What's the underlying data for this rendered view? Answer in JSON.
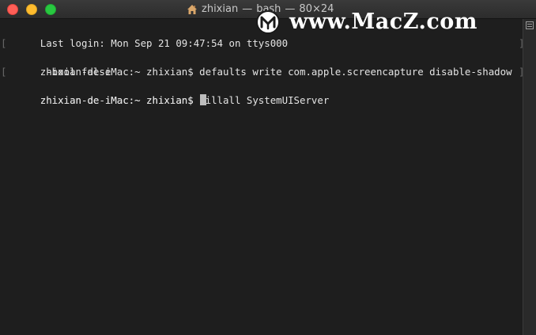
{
  "window": {
    "title_user": "zhixian",
    "title_sep1": "—",
    "title_shell": "bash",
    "title_sep2": "—",
    "title_size": "80×24"
  },
  "watermark": {
    "text": "www.MacZ.com"
  },
  "terminal": {
    "lines": [
      "Last login: Mon Sep 21 09:47:54 on ttys000",
      "zhixian-de-iMac:~ zhixian$ defaults write com.apple.screencapture disable-shadow",
      " -bool false",
      "zhixian-de-iMac:~ zhixian$ killall SystemUIServer",
      "zhixian-de-iMac:~ zhixian$ "
    ]
  },
  "icons": {
    "home": "house-icon",
    "split": "split-pane-icon",
    "close": "close-button",
    "minimize": "minimize-button",
    "maximize": "zoom-button"
  },
  "colors": {
    "background": "#1e1e1e",
    "text": "#e4e4e4",
    "close": "#ff5f57",
    "minimize": "#febc2e",
    "maximize": "#28c840"
  }
}
